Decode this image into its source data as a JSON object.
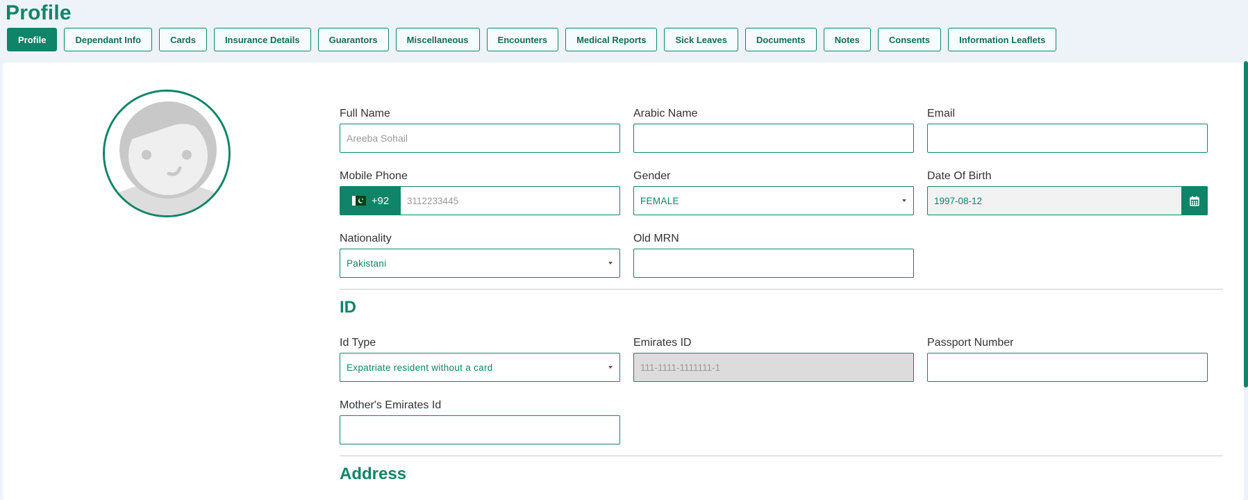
{
  "page": {
    "title": "Profile"
  },
  "tabs": [
    {
      "label": "Profile",
      "active": true
    },
    {
      "label": "Dependant Info"
    },
    {
      "label": "Cards"
    },
    {
      "label": "Insurance Details"
    },
    {
      "label": "Guarantors"
    },
    {
      "label": "Miscellaneous"
    },
    {
      "label": "Encounters"
    },
    {
      "label": "Medical Reports"
    },
    {
      "label": "Sick Leaves"
    },
    {
      "label": "Documents"
    },
    {
      "label": "Notes"
    },
    {
      "label": "Consents"
    },
    {
      "label": "Information Leaflets"
    }
  ],
  "form": {
    "full_name": {
      "label": "Full Name",
      "placeholder": "Areeba Sohail",
      "value": ""
    },
    "arabic_name": {
      "label": "Arabic Name",
      "value": ""
    },
    "email": {
      "label": "Email",
      "value": ""
    },
    "mobile_phone": {
      "label": "Mobile Phone",
      "country_code": "+92",
      "placeholder": "3112233445",
      "value": ""
    },
    "gender": {
      "label": "Gender",
      "value": "FEMALE"
    },
    "date_of_birth": {
      "label": "Date Of Birth",
      "value": "1997-08-12"
    },
    "nationality": {
      "label": "Nationality",
      "value": "Pakistani"
    },
    "old_mrn": {
      "label": "Old MRN",
      "value": ""
    }
  },
  "id_section": {
    "title": "ID",
    "id_type": {
      "label": "Id Type",
      "value": "Expatriate resident without a card"
    },
    "emirates_id": {
      "label": "Emirates ID",
      "placeholder": "111-1111-1111111-1"
    },
    "passport_number": {
      "label": "Passport Number",
      "value": ""
    },
    "mothers_emirates_id": {
      "label": "Mother's Emirates Id",
      "value": ""
    }
  },
  "address_section": {
    "title": "Address"
  },
  "colors": {
    "accent": "#0f8468",
    "page_bg": "#eef3fa",
    "disabled": "#dcdcdc"
  },
  "icons": {
    "calendar": "calendar-icon",
    "avatar": "avatar-placeholder",
    "flag": "pakistan-flag-icon"
  }
}
